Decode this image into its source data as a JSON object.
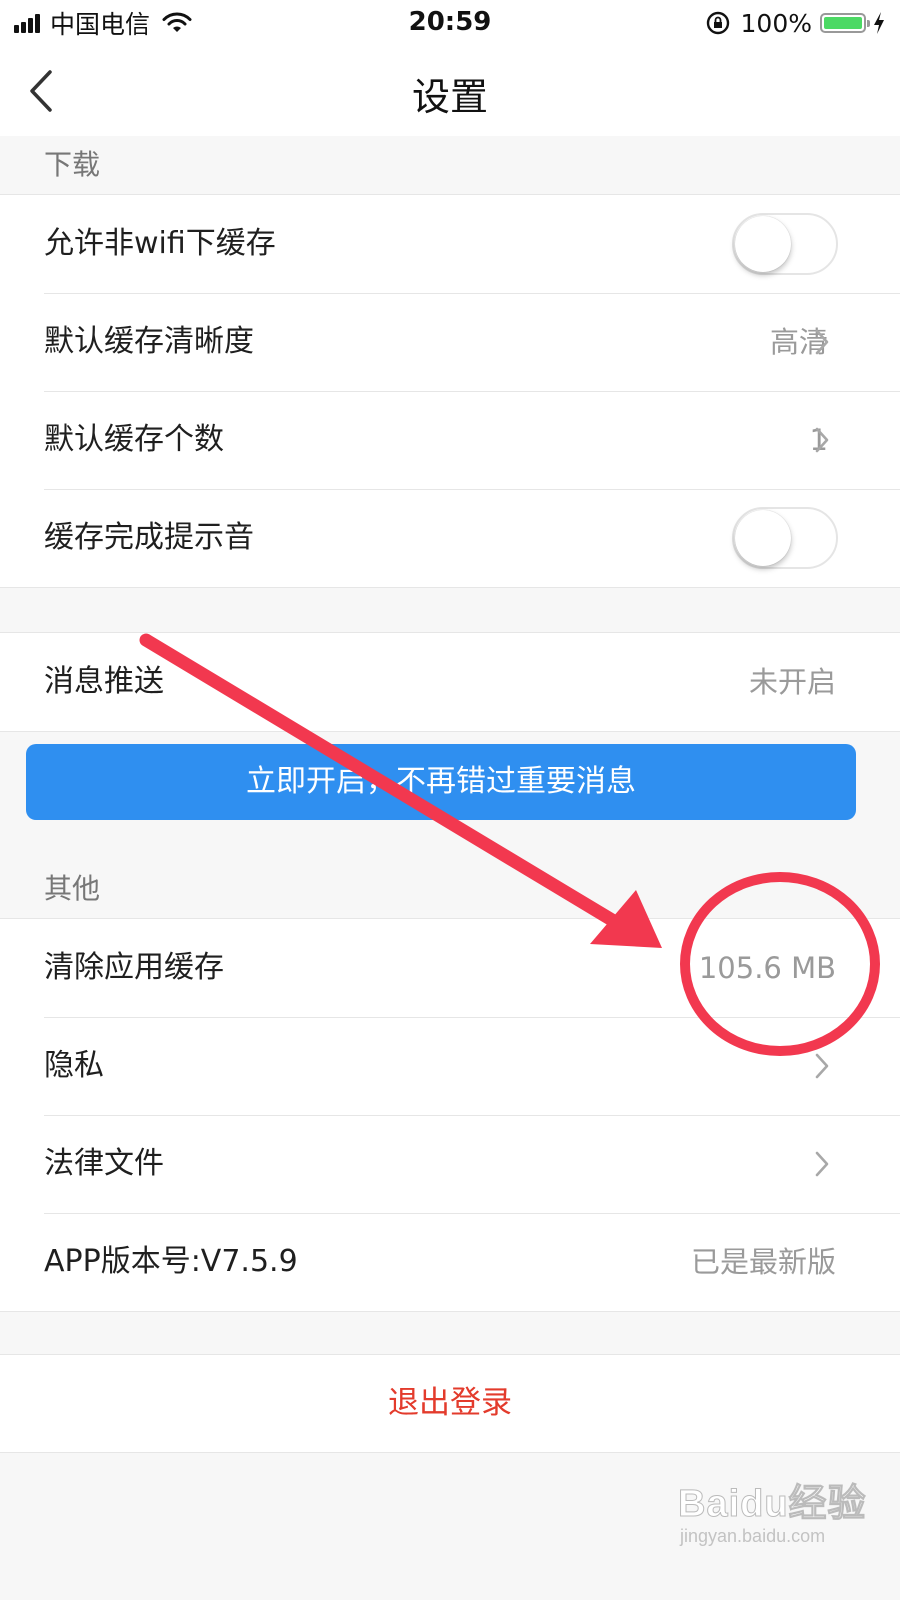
{
  "status_bar": {
    "carrier": "中国电信",
    "time": "20:59",
    "battery_percent": "100%",
    "battery_level": 1.0,
    "battery_color": "#4cd964"
  },
  "nav": {
    "back_icon": "chevron-left-icon",
    "title": "设置"
  },
  "download_section": {
    "header": "下载",
    "rows": [
      {
        "label": "允许非wifi下缓存",
        "type": "toggle",
        "on": false
      },
      {
        "label": "默认缓存清晰度",
        "value": "高清",
        "type": "disclosure"
      },
      {
        "label": "默认缓存个数",
        "value": "1",
        "type": "disclosure"
      },
      {
        "label": "缓存完成提示音",
        "type": "toggle",
        "on": false
      }
    ]
  },
  "push_section": {
    "row": {
      "label": "消息推送",
      "value": "未开启"
    },
    "enable_button": "立即开启，不再错过重要消息",
    "enable_button_color": "#2f8ff0"
  },
  "other_section": {
    "header": "其他",
    "rows": [
      {
        "label": "清除应用缓存",
        "value": "105.6 MB",
        "type": "value"
      },
      {
        "label": "隐私",
        "type": "disclosure"
      },
      {
        "label": "法律文件",
        "type": "disclosure"
      },
      {
        "label": "APP版本号:V7.5.9",
        "value": "已是最新版",
        "type": "value"
      }
    ]
  },
  "logout": {
    "label": "退出登录",
    "color": "#e33b2c"
  },
  "annotation": {
    "color": "#f2384f",
    "arrow": "arrow pointing to cache size",
    "circle": "circle around cache size"
  },
  "watermark": {
    "brand": "Baidu经验",
    "url": "jingyan.baidu.com"
  }
}
